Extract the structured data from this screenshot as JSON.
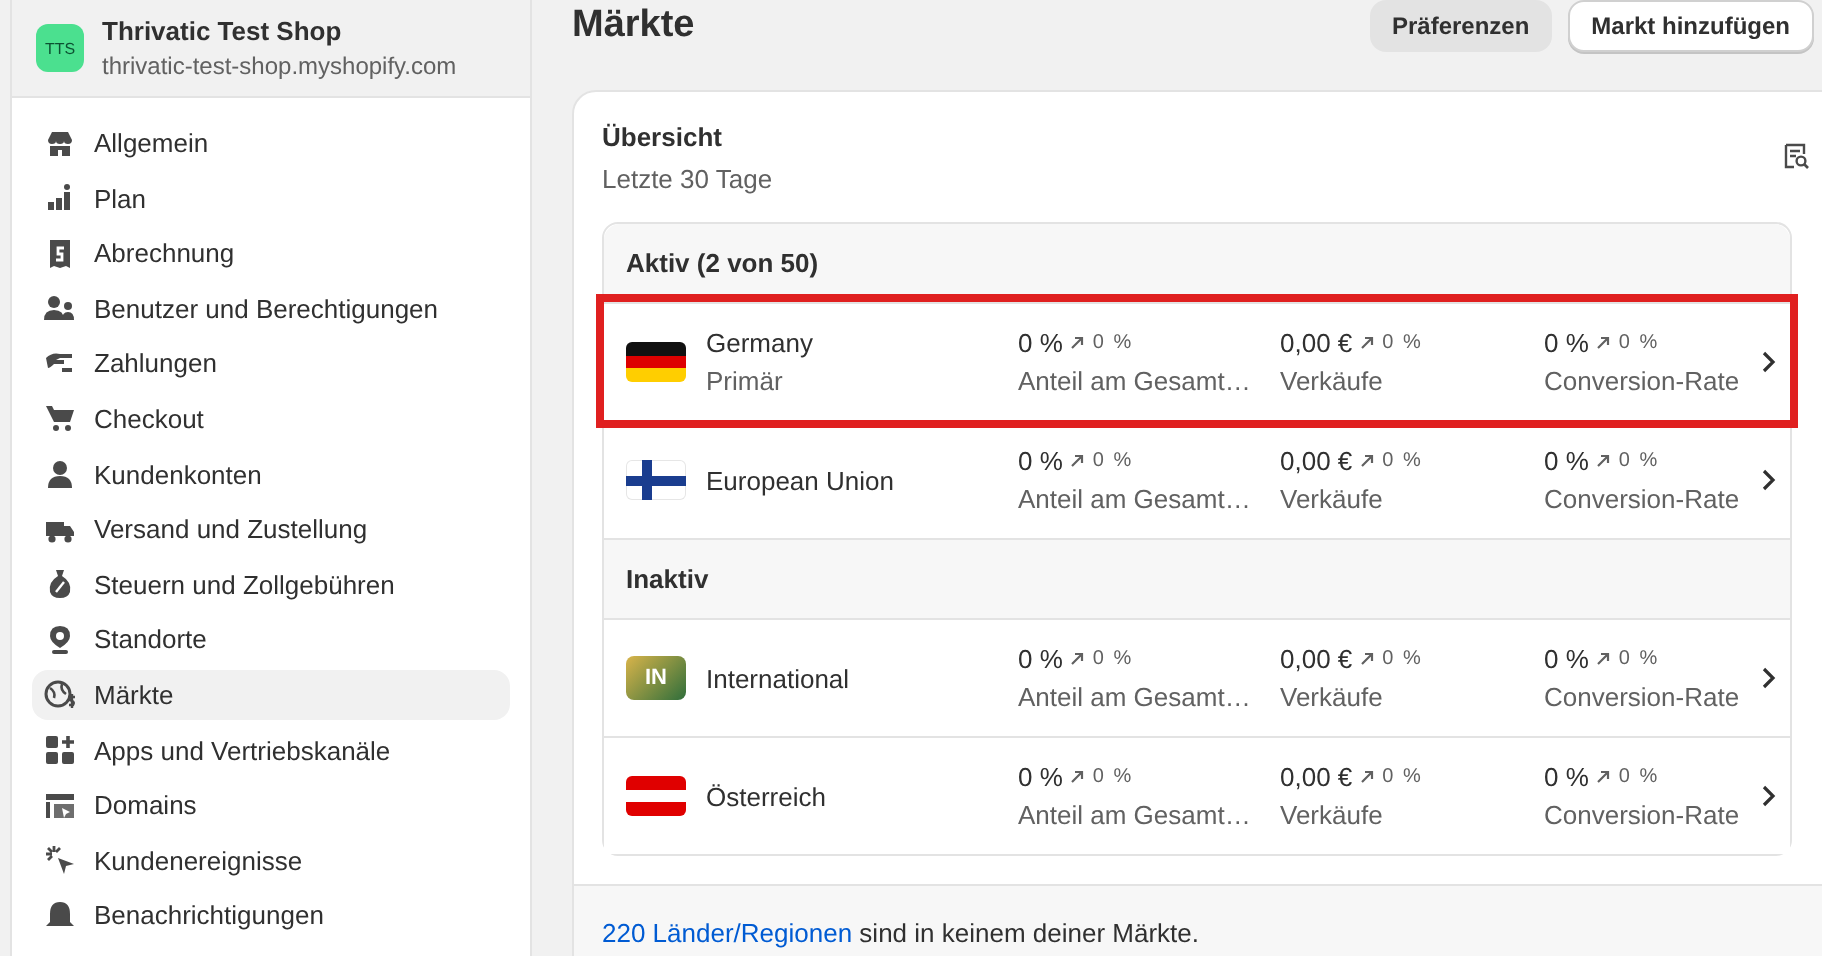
{
  "shop": {
    "initials": "TTS",
    "name": "Thrivatic Test Shop",
    "domain": "thrivatic-test-shop.myshopify.com"
  },
  "sidebar": {
    "items": [
      {
        "label": "Allgemein",
        "selected": false
      },
      {
        "label": "Plan",
        "selected": false
      },
      {
        "label": "Abrechnung",
        "selected": false
      },
      {
        "label": "Benutzer und Berechtigungen",
        "selected": false
      },
      {
        "label": "Zahlungen",
        "selected": false
      },
      {
        "label": "Checkout",
        "selected": false
      },
      {
        "label": "Kundenkonten",
        "selected": false
      },
      {
        "label": "Versand und Zustellung",
        "selected": false
      },
      {
        "label": "Steuern und Zollgebühren",
        "selected": false
      },
      {
        "label": "Standorte",
        "selected": false
      },
      {
        "label": "Märkte",
        "selected": true
      },
      {
        "label": "Apps und Vertriebskanäle",
        "selected": false
      },
      {
        "label": "Domains",
        "selected": false
      },
      {
        "label": "Kundenereignisse",
        "selected": false
      },
      {
        "label": "Benachrichtigungen",
        "selected": false
      }
    ]
  },
  "page": {
    "title": "Märkte",
    "buttons": [
      {
        "label": "Präferenzen",
        "kind": "secondary"
      },
      {
        "label": "Markt hinzufügen",
        "kind": "primary"
      }
    ]
  },
  "overview": {
    "title": "Übersicht",
    "period": "Letzte 30 Tage",
    "groups": [
      {
        "title": "Aktiv (2 von 50)",
        "markets": [
          {
            "name": "Germany",
            "subtitle": "Primär",
            "kind": "flag",
            "highlighted": true,
            "metrics": [
              {
                "value": "0 %",
                "change": "0 %",
                "label": "Anteil am Gesamt…"
              },
              {
                "value": "0,00 €",
                "change": "0 %",
                "label": "Verkäufe"
              },
              {
                "value": "0 %",
                "change": "0 %",
                "label": "Conversion-Rate"
              }
            ]
          },
          {
            "name": "European Union",
            "kind": "flag",
            "highlighted": false,
            "metrics": [
              {
                "value": "0 %",
                "change": "0 %",
                "label": "Anteil am Gesamt…"
              },
              {
                "value": "0,00 €",
                "change": "0 %",
                "label": "Verkäufe"
              },
              {
                "value": "0 %",
                "change": "0 %",
                "label": "Conversion-Rate"
              }
            ]
          }
        ]
      },
      {
        "title": "Inaktiv",
        "markets": [
          {
            "name": "International",
            "kind": "badge",
            "badge": "IN",
            "highlighted": false,
            "metrics": [
              {
                "value": "0 %",
                "change": "0 %",
                "label": "Anteil am Gesamt…"
              },
              {
                "value": "0,00 €",
                "change": "0 %",
                "label": "Verkäufe"
              },
              {
                "value": "0 %",
                "change": "0 %",
                "label": "Conversion-Rate"
              }
            ]
          },
          {
            "name": "Österreich",
            "kind": "flag",
            "highlighted": false,
            "metrics": [
              {
                "value": "0 %",
                "change": "0 %",
                "label": "Anteil am Gesamt…"
              },
              {
                "value": "0,00 €",
                "change": "0 %",
                "label": "Verkäufe"
              },
              {
                "value": "0 %",
                "change": "0 %",
                "label": "Conversion-Rate"
              }
            ]
          }
        ]
      }
    ]
  },
  "footer": {
    "link": "220 Länder/Regionen",
    "text": "sind in keinem deiner Märkte."
  }
}
